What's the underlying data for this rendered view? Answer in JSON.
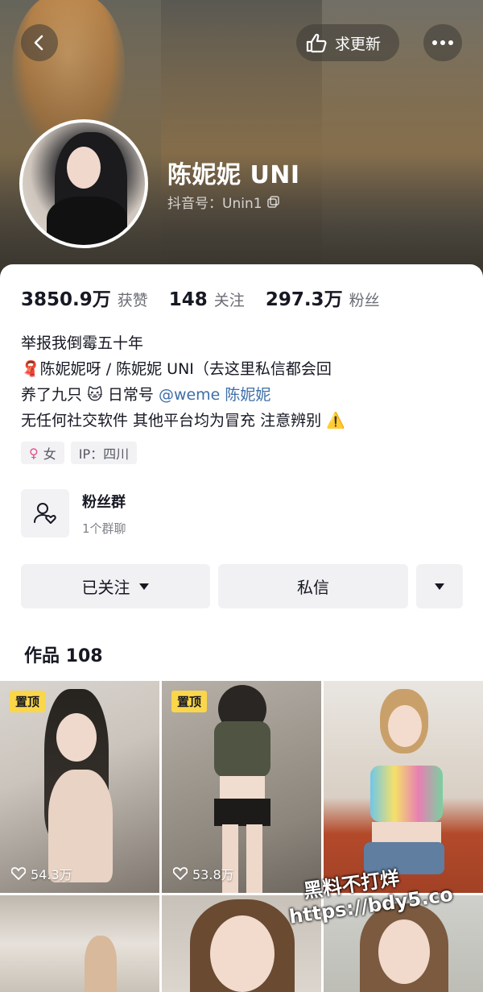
{
  "header": {
    "update_label": "求更新",
    "icons": {
      "back": "back-chevron-icon",
      "update": "hand-point-icon",
      "more": "more-dots-icon"
    }
  },
  "profile": {
    "name": "陈妮妮 UNI",
    "douyin_id": "抖音号：Unin1"
  },
  "stats": [
    {
      "value": "3850.9万",
      "label": "获赞"
    },
    {
      "value": "148",
      "label": "关注"
    },
    {
      "value": "297.3万",
      "label": "粉丝"
    }
  ],
  "bio": {
    "line1": "举报我倒霉五十年",
    "line2": "🧣陈妮妮呀 / 陈妮妮 UNI（去这里私信都会回",
    "line3_prefix": "养了九只 🐱 日常号 ",
    "line3_link": "@weme 陈妮妮",
    "line4": "无任何社交软件 其他平台均为冒充 注意辨别 ⚠️"
  },
  "tags": {
    "gender": "女",
    "ip": "IP：四川"
  },
  "fan_group": {
    "title": "粉丝群",
    "subtitle": "1个群聊"
  },
  "actions": {
    "follow": "已关注",
    "message": "私信"
  },
  "works": {
    "title": "作品 108",
    "tiles": [
      {
        "pinned": true,
        "pin_label": "置顶",
        "likes": "54.3万"
      },
      {
        "pinned": true,
        "pin_label": "置顶",
        "likes": "53.8万"
      },
      {
        "pinned": false,
        "pin_label": "",
        "likes": ""
      }
    ]
  },
  "watermark": {
    "line1": "黑料不打烊",
    "line2": "https://bdy5.co"
  },
  "colors": {
    "pin_bg": "#fad64a",
    "link": "#3d6ea8",
    "gender": "#e0508c"
  }
}
